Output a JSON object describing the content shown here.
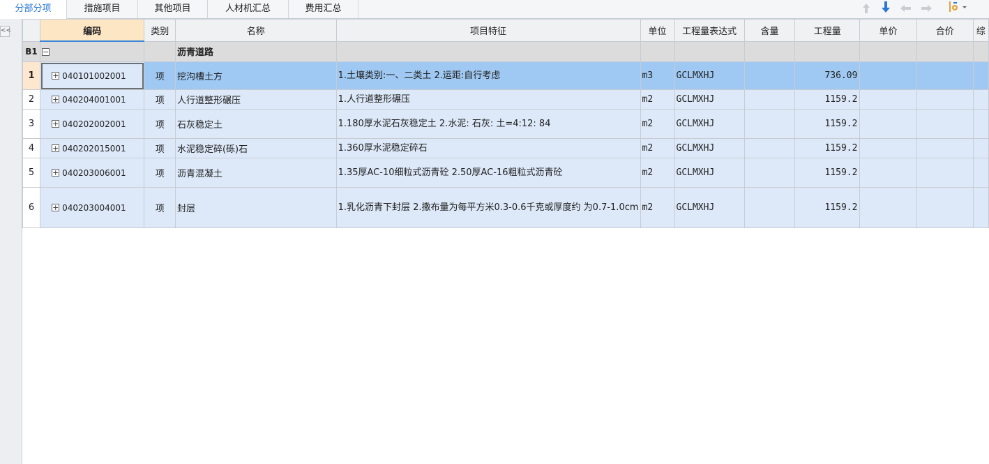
{
  "tabs": [
    {
      "label": "分部分项",
      "active": true
    },
    {
      "label": "措施项目",
      "active": false
    },
    {
      "label": "其他项目",
      "active": false
    },
    {
      "label": "人材机汇总",
      "active": false
    },
    {
      "label": "费用汇总",
      "active": false
    }
  ],
  "toolbar": {
    "icons": [
      "arrow-up-icon",
      "arrow-down-icon",
      "arrow-left-icon",
      "arrow-right-icon",
      "settings-dropdown-icon"
    ],
    "accent": "#2a78d4"
  },
  "collapse_label": "<<",
  "columns": [
    "编码",
    "类别",
    "名称",
    "项目特征",
    "单位",
    "工程量表达式",
    "含量",
    "工程量",
    "单价",
    "合价",
    "综"
  ],
  "group": {
    "id": "B1",
    "toggle": "−",
    "name": "沥青道路"
  },
  "rows": [
    {
      "num": "1",
      "code": "040101002001",
      "type": "项",
      "name": "挖沟槽土方",
      "features": "1.土壤类别:一、二类土\n2.运距:自行考虑",
      "unit": "m3",
      "expr": "GCLMXHJ",
      "qty": "736.09",
      "selected": true
    },
    {
      "num": "2",
      "code": "040204001001",
      "type": "项",
      "name": "人行道整形碾压",
      "features": "1.人行道整形碾压",
      "unit": "m2",
      "expr": "GCLMXHJ",
      "qty": "1159.2",
      "selected": false
    },
    {
      "num": "3",
      "code": "040202002001",
      "type": "项",
      "name": "石灰稳定土",
      "features": "1.180厚水泥石灰稳定土\n2.水泥: 石灰: 土=4:12: 84",
      "unit": "m2",
      "expr": "GCLMXHJ",
      "qty": "1159.2",
      "selected": false
    },
    {
      "num": "4",
      "code": "040202015001",
      "type": "项",
      "name": "水泥稳定碎(砾)石",
      "features": "1.360厚水泥稳定碎石",
      "unit": "m2",
      "expr": "GCLMXHJ",
      "qty": "1159.2",
      "selected": false
    },
    {
      "num": "5",
      "code": "040203006001",
      "type": "项",
      "name": "沥青混凝土",
      "features": "1.35厚AC-10细粒式沥青砼\n2.50厚AC-16粗粒式沥青砼",
      "unit": "m2",
      "expr": "GCLMXHJ",
      "qty": "1159.2",
      "selected": false
    },
    {
      "num": "6",
      "code": "040203004001",
      "type": "项",
      "name": "封层",
      "features": "1.乳化沥青下封层\n2.撒布量为每平方米0.3-0.6千克或厚度约\n为0.7-1.0cm",
      "unit": "m2",
      "expr": "GCLMXHJ",
      "qty": "1159.2",
      "selected": false
    }
  ],
  "expand_symbol": "+"
}
